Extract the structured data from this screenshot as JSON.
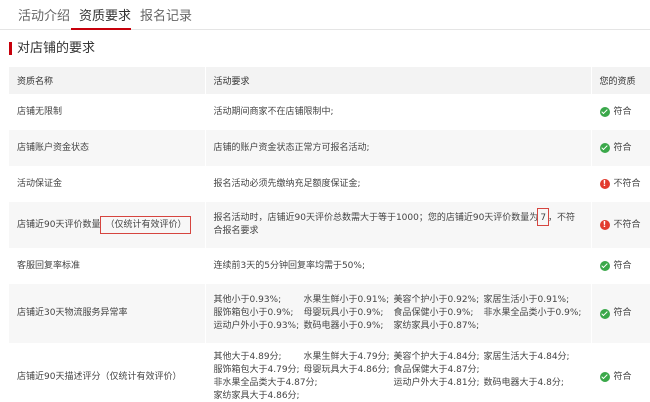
{
  "tabs": [
    {
      "label": "活动介绍",
      "active": false
    },
    {
      "label": "资质要求",
      "active": true
    },
    {
      "label": "报名记录",
      "active": false
    }
  ],
  "section_title": "对店铺的要求",
  "table": {
    "headers": [
      "资质名称",
      "活动要求",
      "您的资质"
    ],
    "rows": [
      {
        "name": "店铺无限制",
        "requirement": "活动期间商家不在店铺限制中;",
        "status": "符合",
        "ok": true
      },
      {
        "name": "店铺账户资金状态",
        "requirement": "店铺的账户资金状态正常方可报名活动;",
        "status": "符合",
        "ok": true
      },
      {
        "name": "活动保证金",
        "requirement": "报名活动必须先缴纳充足额度保证金;",
        "status": "不符合",
        "ok": false
      },
      {
        "name": "店铺近90天评价数量",
        "name_note": "（仅统计有效评价）",
        "requirement": "报名活动时，店铺近90天评价总数需大于等于1000；您的店铺近90天评价数量为",
        "requirement_value": "7",
        "requirement_tail": "，不符合报名要求",
        "status": "不符合",
        "ok": false
      },
      {
        "name": "客服回复率标准",
        "requirement": "连续前3天的5分钟回复率均需于50%;",
        "status": "符合",
        "ok": true
      },
      {
        "name": "店铺近30天物流服务异常率",
        "grid": [
          "其他小于0.93%;",
          "水果生鲜小于0.91%;",
          "美容个护小于0.92%;",
          "家居生活小于0.91%;",
          "服饰箱包小于0.9%;",
          "母婴玩具小于0.9%;",
          "食品保健小于0.9%;",
          "非水果全品类小于0.9%;",
          "运动户外小于0.93%;",
          "数码电器小于0.9%;",
          "家纺家具小于0.87%;",
          ""
        ],
        "status": "符合",
        "ok": true
      },
      {
        "name": "店铺近90天描述评分（仅统计有效评价）",
        "grid": [
          "其他大于4.89分;",
          "水果生鲜大于4.79分;",
          "美容个护大于4.84分;",
          "家居生活大于4.84分;",
          "服饰箱包大于4.79分;",
          "母婴玩具大于4.86分;",
          "食品保健大于4.87分;",
          "",
          "非水果全品类大于4.87分;",
          "",
          "运动户外大于4.81分;",
          "数码电器大于4.8分;",
          "家纺家具大于4.86分;",
          "",
          "",
          ""
        ],
        "status": "符合",
        "ok": true
      }
    ]
  },
  "colors": {
    "accent": "#c7000b",
    "ok": "#3aa84a",
    "bad": "#e23b2e",
    "highlight_box": "#d6453f"
  },
  "icons": {
    "ok": "check-circle-icon",
    "bad": "exclamation-circle-icon"
  }
}
